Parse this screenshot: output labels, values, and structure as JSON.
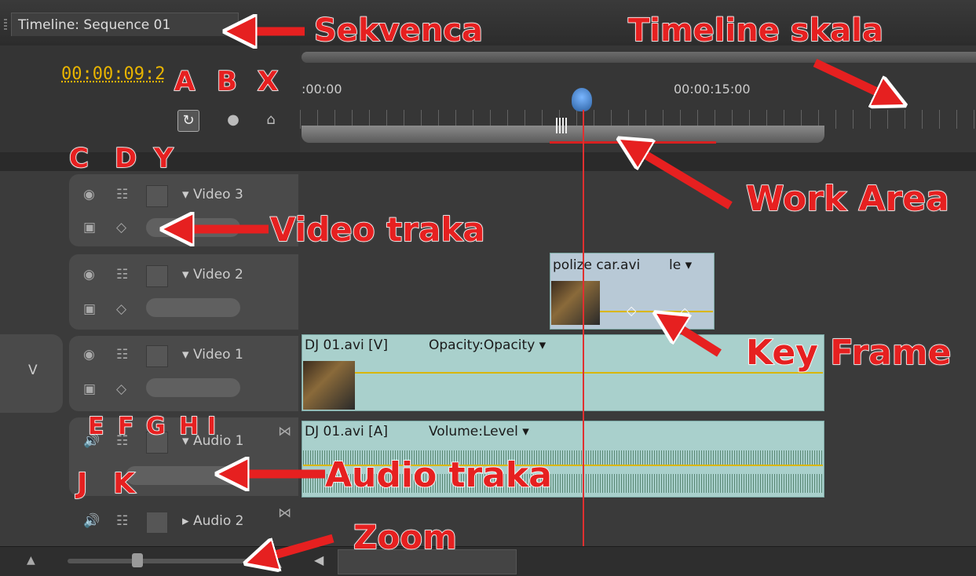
{
  "panel_title": "Timeline: Sequence 01",
  "timecode": "00:00:09:2",
  "ruler": {
    "start_label": ":00:00",
    "mid_label": "00:00:15:00"
  },
  "tracks": {
    "video3": {
      "name": "Video 3"
    },
    "video2": {
      "name": "Video 2"
    },
    "video1": {
      "name": "Video 1",
      "target_label": "V"
    },
    "audio1": {
      "name": "Audio 1"
    },
    "audio2": {
      "name": "Audio 2"
    }
  },
  "clips": {
    "video2_clip": {
      "label": "polize car.avi",
      "suffix": "le"
    },
    "video1_clip": {
      "label": "DJ 01.avi [V]",
      "effect": "Opacity:Opacity"
    },
    "audio1_clip": {
      "label": "DJ 01.avi [A]",
      "effect": "Volume:Level"
    }
  },
  "annotations": {
    "sekvenca": "Sekvenca",
    "timeline_skala": "Timeline skala",
    "work_area": "Work Area",
    "video_traka": "Video traka",
    "key_frame": "Key Frame",
    "audio_traka": "Audio traka",
    "zoom": "Zoom",
    "letters_abx": [
      "A",
      "B",
      "X"
    ],
    "letters_cdy": [
      "C",
      "D",
      "Y"
    ],
    "letters_efghi": [
      "E",
      "F",
      "G",
      "H",
      "I"
    ],
    "letters_jk": [
      "J",
      "K"
    ]
  },
  "colors": {
    "timecode": "#e8b400",
    "annotation": "#e62020",
    "clip": "#a9d0cc",
    "playhead": "#e03030"
  },
  "icons": [
    "eye-icon",
    "filmstrip-icon",
    "speaker-icon",
    "keyframe-icon",
    "snap-icon",
    "marker-icon"
  ]
}
